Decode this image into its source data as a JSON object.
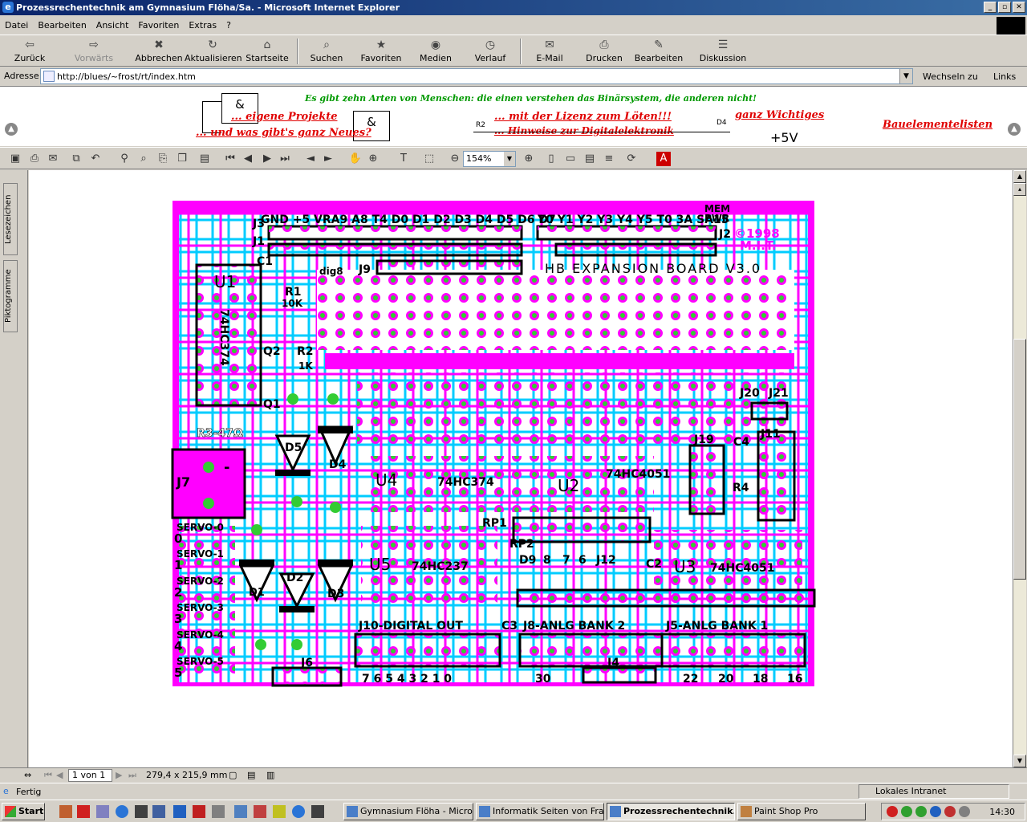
{
  "window": {
    "title": "Prozessrechentechnik am Gymnasium Flöha/Sa. - Microsoft Internet Explorer"
  },
  "menu": [
    "Datei",
    "Bearbeiten",
    "Ansicht",
    "Favoriten",
    "Extras",
    "?"
  ],
  "toolbar": {
    "back": "Zurück",
    "forward": "Vorwärts",
    "stop": "Abbrechen",
    "refresh": "Aktualisieren",
    "home": "Startseite",
    "search": "Suchen",
    "favorites": "Favoriten",
    "media": "Medien",
    "history": "Verlauf",
    "mail": "E-Mail",
    "print": "Drucken",
    "edit": "Bearbeiten",
    "discuss": "Diskussion"
  },
  "address": {
    "label": "Adresse",
    "url": "http://blues/~frost/rt/index.htm",
    "go": "Wechseln zu",
    "links": "Links"
  },
  "webpage": {
    "tagline": "Es gibt zehn Arten von Menschen: die einen verstehen das Binärsystem, die anderen nicht!",
    "nav1": "... eigene Projekte",
    "nav2": "... und was gibt's ganz Neues?",
    "nav3": "... mit der Lizenz zum Löten!!!",
    "nav4": "... Hinweise zur Digitalelektronik",
    "nav5": "ganz Wichtiges",
    "nav6": "Bauelementelisten",
    "gate_symbol": "&",
    "circuit_r2": "R2",
    "circuit_d4": "D4",
    "circuit_5v": "+5V"
  },
  "pdf": {
    "zoom": "154%",
    "page_field": "1 von 1",
    "page_size": "279,4 x 215,9 mm",
    "sidetab1": "Lesezeichen",
    "sidetab2": "Piktogramme"
  },
  "board": {
    "top_header_left": "GND +5 VRA9 A8 T4 D0 D1 D2 D3 D4 D5 D6 D7",
    "top_header_right": "Y0 Y1 Y2 Y3 Y4 Y5 T0 3A SA15",
    "mem": "MEM",
    "pwr": "PWR",
    "copyright": "©1998",
    "mit": "M.I.T.",
    "title": "HB EXPANSION BOARD V3.0",
    "labels": [
      "J3",
      "J1",
      "C1",
      "J2",
      "U1",
      "74HC374",
      "R1",
      "10K",
      "dig8",
      "J9",
      "Q2",
      "R2",
      "1K",
      "Q1",
      "R3-47Ω",
      "D5",
      "D4",
      "J7",
      "U4",
      "74HC374",
      "U2",
      "74HC4051",
      "J19",
      "C4",
      "J11",
      "J20",
      "J21",
      "R4",
      "RP1",
      "RP2",
      "D9",
      "8",
      "7",
      "6",
      "J12",
      "C2",
      "U3",
      "74HC4051",
      "U5",
      "74HC237",
      "D1",
      "D2",
      "D3",
      "SERVO-0",
      "SERVO-1",
      "SERVO-2",
      "SERVO-3",
      "SERVO-4",
      "SERVO-5",
      "0",
      "1",
      "2",
      "3",
      "4",
      "5",
      "J10-DIGITAL OUT",
      "C3",
      "J8-ANLG BANK 2",
      "J5-ANLG BANK 1",
      "J6",
      "J4",
      "7 6 5 4 3 2 1 0",
      "30",
      "22",
      "20",
      "18",
      "16",
      "+",
      "-"
    ]
  },
  "status": {
    "left": "Fertig",
    "zone": "Lokales Intranet"
  },
  "taskbar": {
    "start": "Start",
    "tasks": [
      "Gymnasium Flöha - Micros...",
      "Informatik Seiten von Fra...",
      "Prozessrechentechnik...",
      "Paint Shop Pro"
    ],
    "clock": "14:30"
  }
}
